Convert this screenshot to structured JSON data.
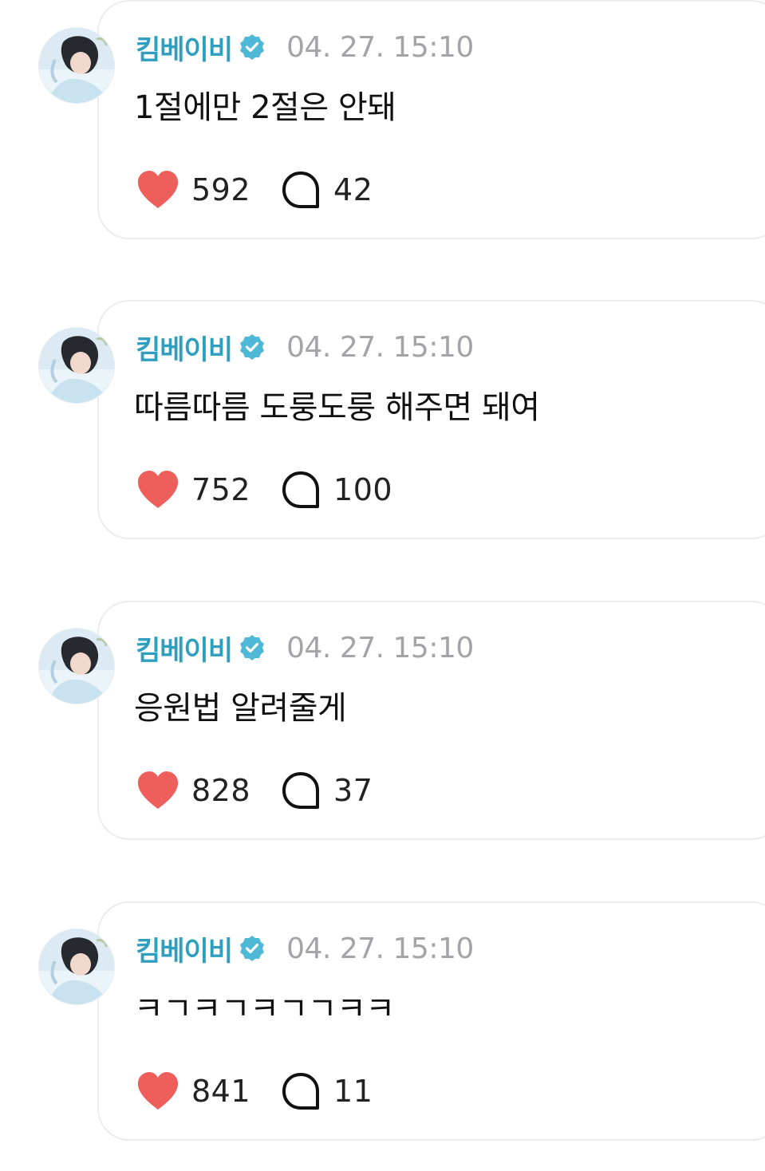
{
  "posts": [
    {
      "author": "킴베이비",
      "timestamp": "04. 27. 15:10",
      "text": "1절에만 2절은 안돼",
      "likes": "592",
      "comments": "42"
    },
    {
      "author": "킴베이비",
      "timestamp": "04. 27. 15:10",
      "text": "따름따름 도룽도룽 해주면 돼여",
      "likes": "752",
      "comments": "100"
    },
    {
      "author": "킴베이비",
      "timestamp": "04. 27. 15:10",
      "text": "응원법 알려줄게",
      "likes": "828",
      "comments": "37"
    },
    {
      "author": "킴베이비",
      "timestamp": "04. 27. 15:10",
      "text": "ㅋㄱㅋㄱㅋㄱㄱㅋㅋ",
      "likes": "841",
      "comments": "11"
    }
  ],
  "icons": {
    "verified": "verified-badge-icon",
    "like": "heart-icon",
    "comment": "comment-bubble-icon",
    "avatar": "profile-photo"
  },
  "colors": {
    "author": "#2f9fbf",
    "verified_badge": "#4fb8d6",
    "heart": "#ee5f5b",
    "timestamp": "#a3a3a8",
    "card_border": "#ececf0"
  }
}
